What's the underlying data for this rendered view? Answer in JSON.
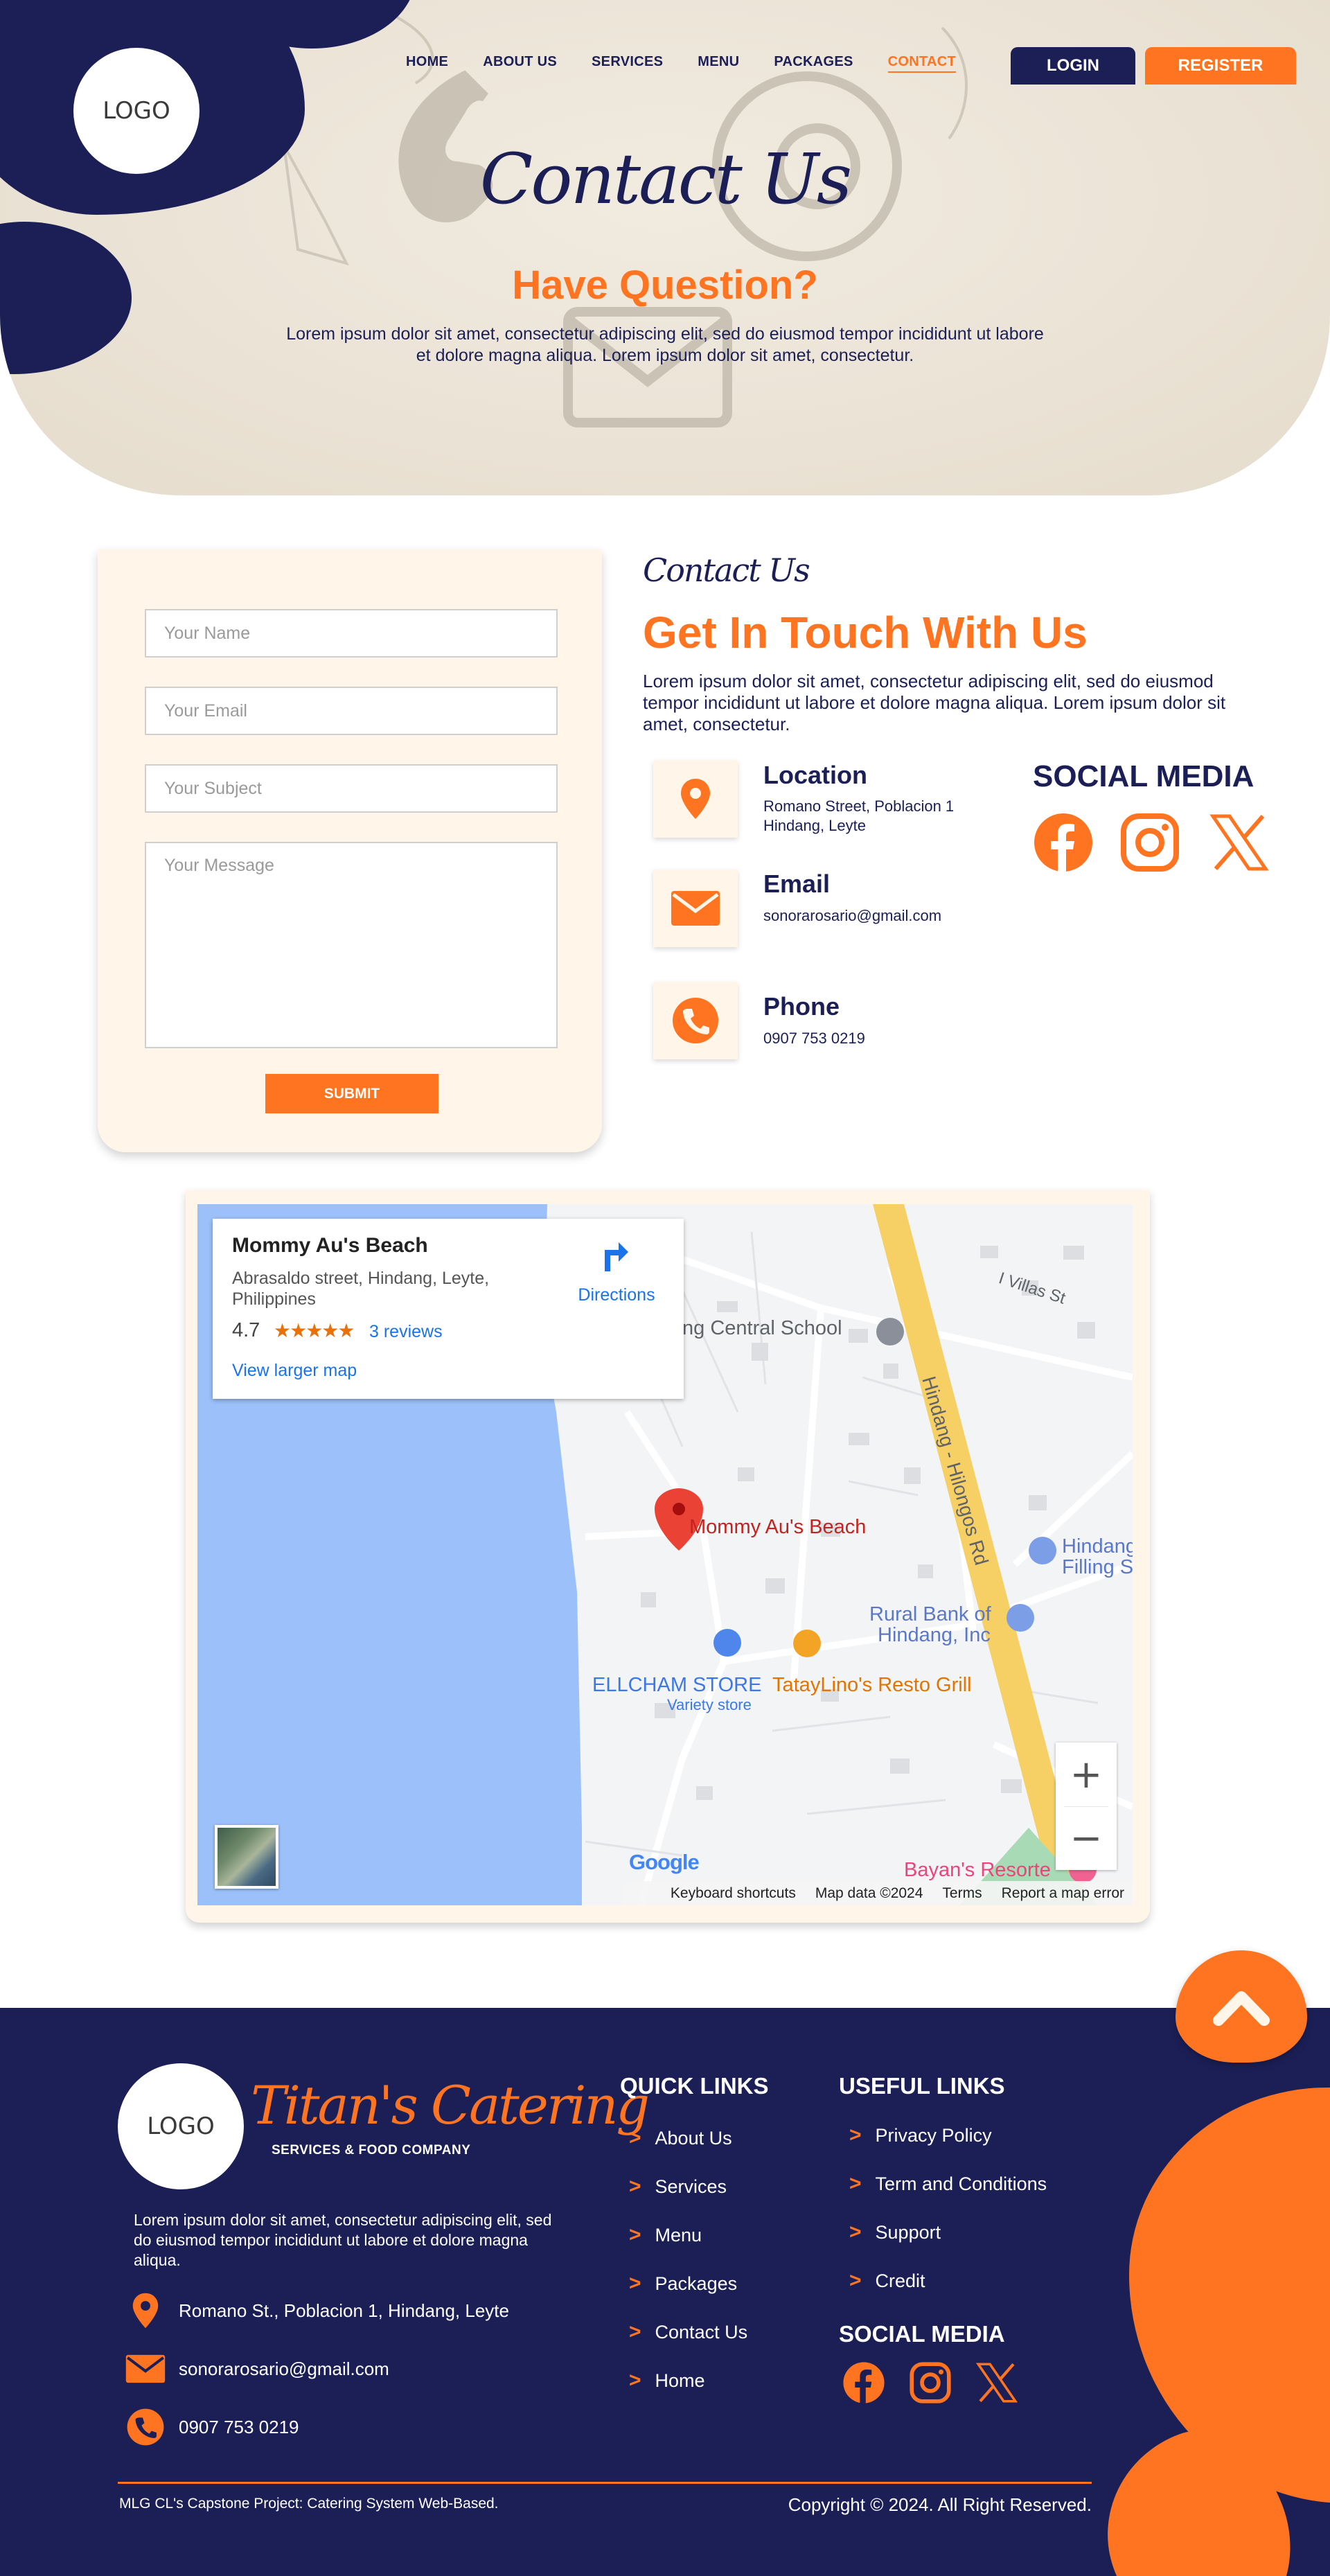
{
  "header": {
    "logo_text": "LOGO",
    "nav": [
      "HOME",
      "ABOUT US",
      "SERVICES",
      "MENU",
      "PACKAGES",
      "CONTACT"
    ],
    "active_nav": "CONTACT",
    "login_label": "LOGIN",
    "register_label": "REGISTER"
  },
  "hero": {
    "title": "Contact Us",
    "subtitle": "Have Question?",
    "text": "Lorem ipsum dolor sit amet, consectetur adipiscing elit, sed do eiusmod tempor incididunt ut labore et dolore magna aliqua. Lorem ipsum dolor sit amet, consectetur."
  },
  "form": {
    "name_placeholder": "Your Name",
    "email_placeholder": "Your Email",
    "subject_placeholder": "Your Subject",
    "message_placeholder": "Your Message",
    "submit_label": "SUBMIT"
  },
  "contact": {
    "script_title": "Contact Us",
    "title": "Get In Touch With Us",
    "description": "Lorem ipsum dolor sit amet, consectetur adipiscing elit, sed do eiusmod tempor incididunt ut labore et dolore magna aliqua. Lorem ipsum dolor sit amet, consectetur.",
    "location_label": "Location",
    "location_line1": "Romano Street, Poblacion 1",
    "location_line2": "Hindang, Leyte",
    "email_label": "Email",
    "email_value": "sonorarosario@gmail.com",
    "phone_label": "Phone",
    "phone_value": "0907 753 0219",
    "social_title": "SOCIAL MEDIA",
    "social_icons": [
      "facebook-icon",
      "instagram-icon",
      "x-icon"
    ]
  },
  "map": {
    "place_name": "Mommy Au's Beach",
    "address": "Abrasaldo street, Hindang, Leyte, Philippines",
    "rating": "4.7",
    "stars": "★★★★★",
    "reviews": "3 reviews",
    "larger_map": "View larger map",
    "directions": "Directions",
    "labels": {
      "school": "ng Central School",
      "road": "Hindang - Hilongos Rd",
      "villas": "I Villas St",
      "pin": "Mommy Au's Beach",
      "filling1": "Hindang",
      "filling2": "Filling S",
      "bank1": "Rural Bank of",
      "bank2": "Hindang, Inc",
      "store": "ELLCHAM STORE",
      "store_sub": "Variety store",
      "resto": "TatayLino's Resto Grill",
      "resort": "Bayan's Resorte"
    },
    "zoom_in": "+",
    "zoom_out": "−",
    "google": "Google",
    "footer_links": [
      "Keyboard shortcuts",
      "Map data ©2024",
      "Terms",
      "Report a map error"
    ]
  },
  "footer": {
    "logo_text": "LOGO",
    "brand": "Titan's Catering",
    "brand_sub": "SERVICES & FOOD COMPANY",
    "description": "Lorem ipsum dolor sit amet, consectetur adipiscing elit, sed do eiusmod tempor incididunt ut labore et dolore magna aliqua.",
    "address": "Romano St., Poblacion 1, Hindang, Leyte",
    "email": "sonorarosario@gmail.com",
    "phone": "0907 753 0219",
    "quick_links_title": "QUICK LINKS",
    "quick_links": [
      "About Us",
      "Services",
      "Menu",
      "Packages",
      "Contact Us",
      "Home"
    ],
    "useful_links_title": "USEFUL LINKS",
    "useful_links": [
      "Privacy Policy",
      "Term and Conditions",
      "Support",
      "Credit"
    ],
    "social_title": "SOCIAL MEDIA",
    "bottom_left": "MLG CL's Capstone Project: Catering System Web-Based.",
    "bottom_right": "Copyright © 2024. All Right Reserved."
  },
  "colors": {
    "navy": "#1b1f56",
    "orange": "#ff7420",
    "cream": "#fff6e9"
  }
}
